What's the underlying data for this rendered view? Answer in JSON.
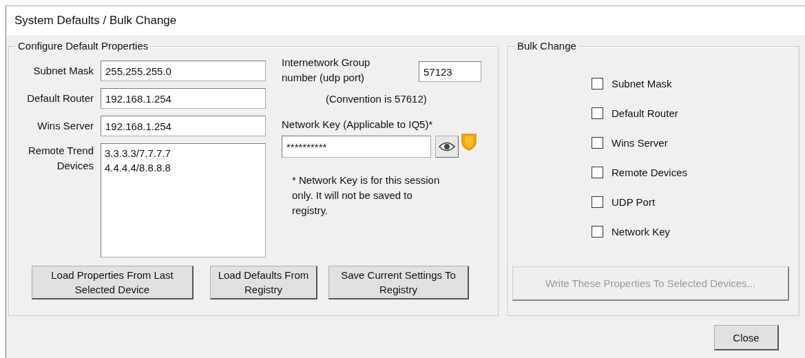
{
  "window": {
    "title": "System Defaults / Bulk Change"
  },
  "configure": {
    "title": "Configure Default Properties",
    "fields": [
      {
        "label": "Subnet Mask",
        "value": "255.255.255.0"
      },
      {
        "label": "Default Router",
        "value": "192.168.1.254"
      },
      {
        "label": "Wins Server",
        "value": "192.168.1.254"
      }
    ],
    "remote": {
      "label": "Remote Trend Devices",
      "lines": [
        "3.3.3.3/7.7.7.7",
        "4.4.4.4/8.8.8.8"
      ]
    },
    "port": {
      "label": "Internetwork Group number (udp port)",
      "value": "57123",
      "hint": "(Convention is 57612)"
    },
    "network_key": {
      "label": "Network Key (Applicable to IQ5)*",
      "value": "**********",
      "note": "* Network Key is for this session only. It will not be saved to registry."
    },
    "buttons": [
      "Load Properties From Last Selected Device",
      "Load Defaults From Registry",
      "Save Current Settings To Registry"
    ]
  },
  "bulk": {
    "title": "Bulk Change",
    "options": [
      {
        "label": "Subnet Mask",
        "checked": false
      },
      {
        "label": "Default Router",
        "checked": false
      },
      {
        "label": "Wins Server",
        "checked": false
      },
      {
        "label": "Remote Devices",
        "checked": false
      },
      {
        "label": "UDP Port",
        "checked": false
      },
      {
        "label": "Network Key",
        "checked": false
      }
    ],
    "write_button": {
      "label": "Write These Properties To Selected Devices...",
      "disabled": true
    }
  },
  "close_button": "Close"
}
